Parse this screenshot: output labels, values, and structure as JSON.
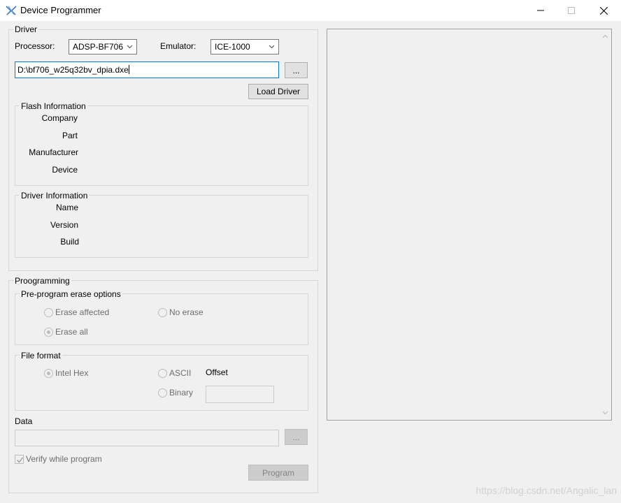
{
  "window": {
    "title": "Device Programmer"
  },
  "driver": {
    "group_label": "Driver",
    "processor_label": "Processor:",
    "processor_value": "ADSP-BF706",
    "emulator_label": "Emulator:",
    "emulator_value": "ICE-1000",
    "path_value": "D:\\bf706_w25q32bv_dpia.dxe",
    "browse_label": "...",
    "load_label": "Load Driver"
  },
  "flash_info": {
    "group_label": "Flash Information",
    "fields": [
      "Company",
      "Part",
      "Manufacturer",
      "Device"
    ]
  },
  "driver_info": {
    "group_label": "Driver Information",
    "fields": [
      "Name",
      "Version",
      "Build"
    ]
  },
  "programming": {
    "group_label": "Proogramming",
    "erase": {
      "group_label": "Pre-program erase options",
      "options": [
        "Erase affected",
        "No erase",
        "Erase all"
      ],
      "selected": "Erase all"
    },
    "file_format": {
      "group_label": "File format",
      "options": [
        "Intel Hex",
        "ASCII",
        "Binary"
      ],
      "selected": "Intel Hex",
      "offset_label": "Offset"
    },
    "data_label": "Data",
    "data_browse_label": "...",
    "verify_label": "Verify while program",
    "program_label": "Program"
  },
  "watermark": "https://blog.csdn.net/Angalic_lan"
}
